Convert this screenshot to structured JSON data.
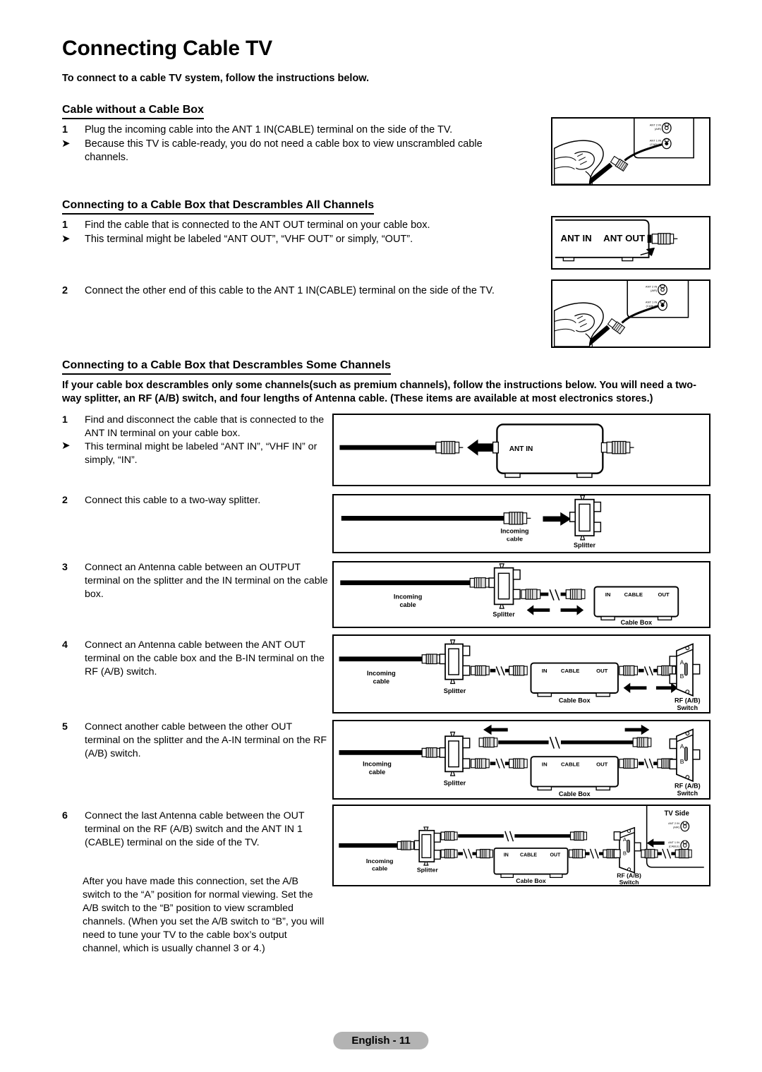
{
  "page": {
    "title": "Connecting Cable TV",
    "intro": "To connect to a cable TV system, follow the instructions below.",
    "footer_label": "English - 11"
  },
  "section1": {
    "heading": "Cable without a Cable Box",
    "steps": [
      {
        "marker": "1",
        "text": "Plug the incoming cable into the ANT 1 IN(CABLE) terminal on the side of the TV."
      },
      {
        "marker": "note",
        "text": "Because this TV is cable-ready, you do not need a cable box to view unscrambled cable channels."
      }
    ]
  },
  "section2": {
    "heading": "Connecting to a Cable Box that Descrambles All Channels",
    "steps": [
      {
        "marker": "1",
        "text": "Find the cable that is connected to the ANT OUT terminal on your cable box."
      },
      {
        "marker": "note",
        "text": "This terminal might be labeled “ANT OUT”, “VHF OUT” or simply, “OUT”."
      },
      {
        "marker": "2",
        "text": "Connect the other end of this cable to the ANT 1 IN(CABLE) terminal on the side of the TV."
      }
    ]
  },
  "section3": {
    "heading": "Connecting to a Cable Box that Descrambles Some Channels",
    "paragraph": "If your cable box descrambles only some channels(such as premium channels), follow the instructions below. You will need a two-way splitter, an RF (A/B) switch, and four lengths of Antenna cable. (These items are available at most electronics stores.)",
    "steps": [
      {
        "marker": "1",
        "text": "Find and disconnect the cable that is connected to the ANT IN terminal on your cable box."
      },
      {
        "marker": "note",
        "text": "This terminal might be labeled “ANT IN”, “VHF IN” or simply, “IN”."
      },
      {
        "marker": "2",
        "text": "Connect this cable to a two-way splitter."
      },
      {
        "marker": "3",
        "text": "Connect an Antenna cable between an OUTPUT terminal on the splitter and the IN terminal on the cable box."
      },
      {
        "marker": "4",
        "text": "Connect an Antenna cable between the ANT OUT terminal on the cable box and the B-IN terminal on the RF (A/B) switch."
      },
      {
        "marker": "5",
        "text": "Connect another cable between the other OUT terminal on the splitter and the A-IN terminal on the RF (A/B) switch."
      },
      {
        "marker": "6",
        "text": "Connect the last Antenna cable between the OUT terminal on the RF (A/B) switch and the ANT IN 1 (CABLE) terminal on the side of the TV."
      }
    ],
    "tail_paragraph": "After you have made this connection, set the A/B switch to the “A” position for normal viewing. Set the A/B switch to the “B” position to view scrambled channels. (When you set the A/B switch to “B”, you will need to tune your TV to the cable box’s output channel, which is usually channel 3 or 4.)"
  },
  "labels": {
    "ant2in": "ANT 2 IN",
    "ant2in_sub": "(AIR)",
    "ant1in": "ANT 1 IN",
    "ant1in_sub": "(CABLE)",
    "ant_in": "ANT IN",
    "ant_out": "ANT OUT",
    "incoming": "Incoming",
    "cable": "cable",
    "splitter": "Splitter",
    "cable_box": "Cable Box",
    "box_in": "IN",
    "box_cable": "CABLE",
    "box_out": "OUT",
    "rf_switch_line1": "RF (A/B)",
    "rf_switch_line2": "Switch",
    "switch_a": "A",
    "switch_b": "B",
    "tv_side": "TV Side"
  },
  "colors": {
    "ink": "#000000",
    "paper": "#ffffff",
    "footer_pill": "#b3b3b3",
    "metal": "#cccccc"
  }
}
